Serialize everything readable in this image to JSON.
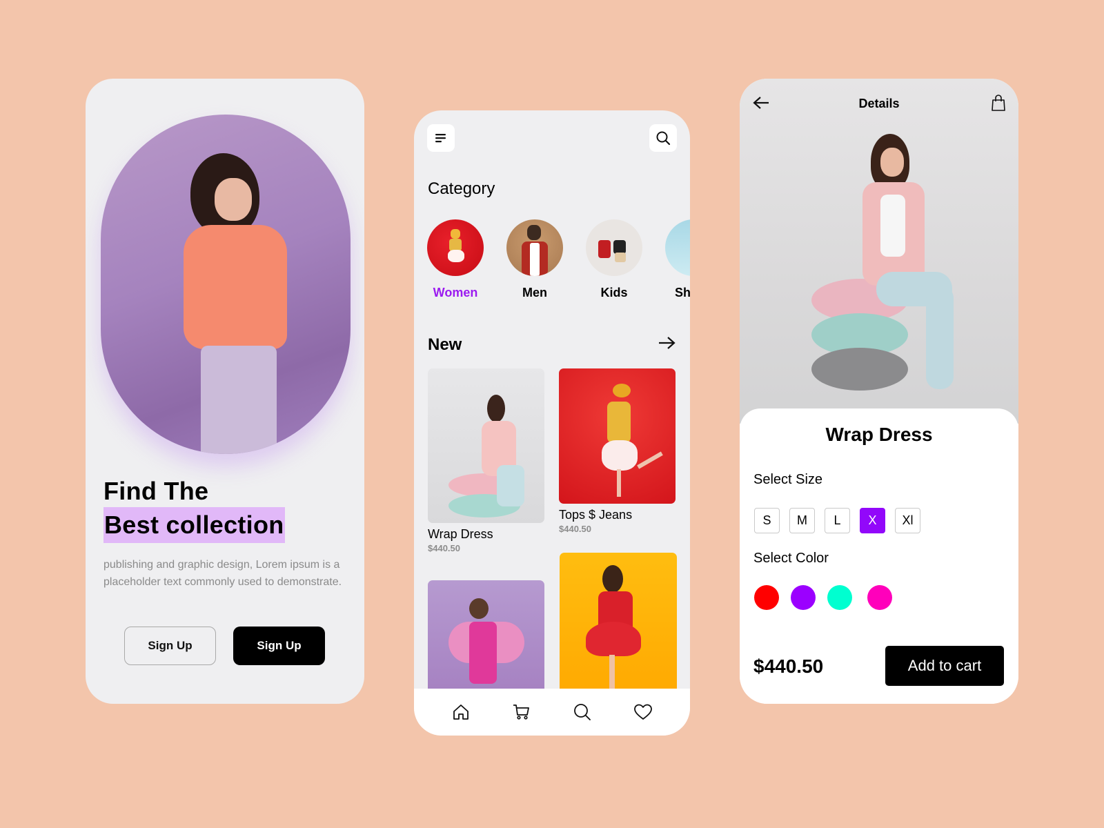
{
  "onboarding": {
    "title_line1": "Find The",
    "title_line2": "Best collection",
    "description": "publishing and graphic design, Lorem ipsum is a placeholder text commonly used to demonstrate.",
    "button_outline_label": "Sign Up",
    "button_solid_label": "Sign Up",
    "highlight_color": "#e1b8f8"
  },
  "home": {
    "menu_icon": "menu-icon",
    "search_icon": "search-icon",
    "category_heading": "Category",
    "categories": [
      {
        "label": "Women",
        "active": true
      },
      {
        "label": "Men",
        "active": false
      },
      {
        "label": "Kids",
        "active": false
      },
      {
        "label": "Shoes",
        "active": false
      }
    ],
    "new_heading": "New",
    "see_all_icon": "arrow-right-icon",
    "products": [
      {
        "name": "Wrap Dress",
        "price": "$440.50"
      },
      {
        "name": "Tops $ Jeans",
        "price": "$440.50"
      },
      {
        "name": "",
        "price": ""
      },
      {
        "name": "",
        "price": ""
      }
    ],
    "tabbar": [
      "home-icon",
      "cart-icon",
      "search-icon",
      "heart-icon"
    ],
    "accent_color": "#9b1bf0"
  },
  "details": {
    "header_title": "Details",
    "back_icon": "arrow-left-icon",
    "bag_icon": "shopping-bag-icon",
    "product_title": "Wrap Dress",
    "select_size_label": "Select Size",
    "sizes": [
      {
        "label": "S",
        "selected": false
      },
      {
        "label": "M",
        "selected": false
      },
      {
        "label": "L",
        "selected": false
      },
      {
        "label": "X",
        "selected": true
      },
      {
        "label": "Xl",
        "selected": false
      }
    ],
    "select_color_label": "Select Color",
    "colors": [
      "#ff0000",
      "#9b00ff",
      "#00ffd0",
      "#ff00bb"
    ],
    "price": "$440.50",
    "add_to_cart_label": "Add to cart",
    "selected_size_color": "#9208fa"
  }
}
